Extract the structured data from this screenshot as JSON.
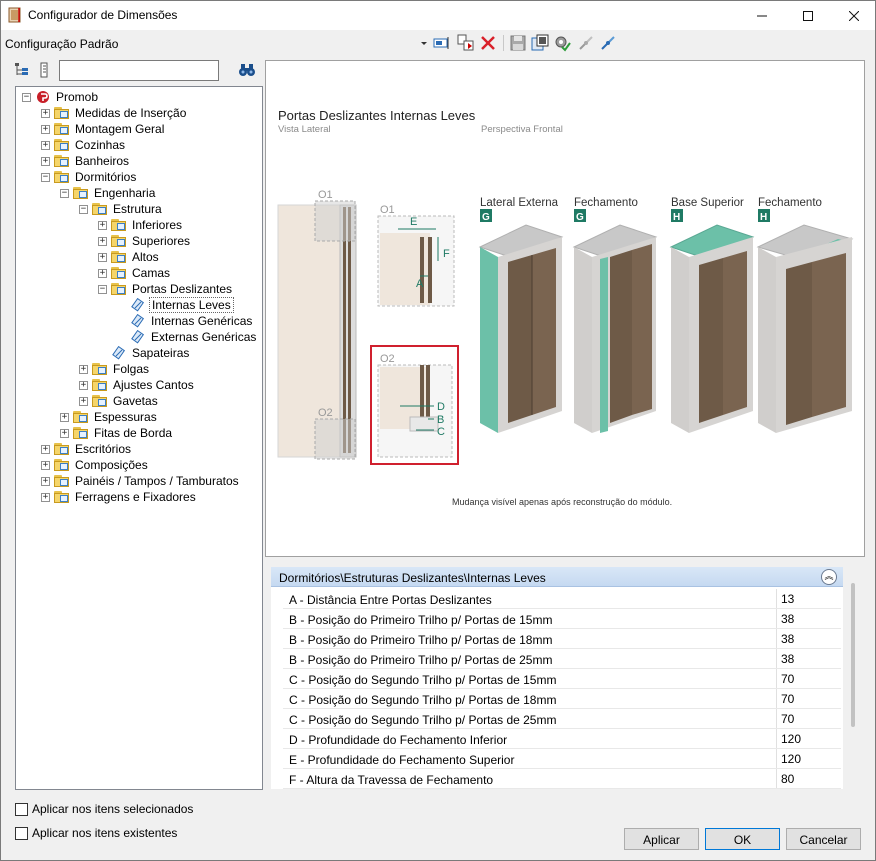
{
  "window": {
    "title": "Configurador de Dimensões"
  },
  "toolbar": {
    "config_name": "Configuração Padrão",
    "search_value": ""
  },
  "tree": {
    "items": [
      {
        "label": "Promob",
        "level": 0,
        "expander": "-",
        "icon": "promob"
      },
      {
        "label": "Medidas de Inserção",
        "level": 1,
        "expander": "+",
        "icon": "folder"
      },
      {
        "label": "Montagem Geral",
        "level": 1,
        "expander": "+",
        "icon": "folder"
      },
      {
        "label": "Cozinhas",
        "level": 1,
        "expander": "+",
        "icon": "folder"
      },
      {
        "label": "Banheiros",
        "level": 1,
        "expander": "+",
        "icon": "folder"
      },
      {
        "label": "Dormitórios",
        "level": 1,
        "expander": "-",
        "icon": "folder"
      },
      {
        "label": "Engenharia",
        "level": 2,
        "expander": "-",
        "icon": "folder"
      },
      {
        "label": "Estrutura",
        "level": 3,
        "expander": "-",
        "icon": "folder"
      },
      {
        "label": "Inferiores",
        "level": 4,
        "expander": "+",
        "icon": "folder"
      },
      {
        "label": "Superiores",
        "level": 4,
        "expander": "+",
        "icon": "folder"
      },
      {
        "label": "Altos",
        "level": 4,
        "expander": "+",
        "icon": "folder"
      },
      {
        "label": "Camas",
        "level": 4,
        "expander": "+",
        "icon": "folder"
      },
      {
        "label": "Portas Deslizantes",
        "level": 4,
        "expander": "-",
        "icon": "folder"
      },
      {
        "label": "Internas Leves",
        "level": 5,
        "expander": "",
        "icon": "item",
        "selected": true
      },
      {
        "label": "Internas Genéricas",
        "level": 5,
        "expander": "",
        "icon": "item"
      },
      {
        "label": "Externas Genéricas",
        "level": 5,
        "expander": "",
        "icon": "item"
      },
      {
        "label": "Sapateiras",
        "level": 4,
        "expander": "",
        "icon": "item"
      },
      {
        "label": "Folgas",
        "level": 3,
        "expander": "+",
        "icon": "folder"
      },
      {
        "label": "Ajustes Cantos",
        "level": 3,
        "expander": "+",
        "icon": "folder"
      },
      {
        "label": "Gavetas",
        "level": 3,
        "expander": "+",
        "icon": "folder"
      },
      {
        "label": "Espessuras",
        "level": 2,
        "expander": "+",
        "icon": "folder"
      },
      {
        "label": "Fitas de Borda",
        "level": 2,
        "expander": "+",
        "icon": "folder"
      },
      {
        "label": "Escritórios",
        "level": 1,
        "expander": "+",
        "icon": "folder"
      },
      {
        "label": "Composições",
        "level": 1,
        "expander": "+",
        "icon": "folder"
      },
      {
        "label": "Painéis / Tampos / Tamburatos",
        "level": 1,
        "expander": "+",
        "icon": "folder"
      },
      {
        "label": "Ferragens e Fixadores",
        "level": 1,
        "expander": "+",
        "icon": "folder"
      }
    ]
  },
  "preview": {
    "title": "Portas Deslizantes Internas Leves",
    "side_view": "Vista Lateral",
    "front_view": "Perspectiva Frontal",
    "o1": "O1",
    "o2": "O2",
    "dim_a": "A",
    "dim_b": "B",
    "dim_c": "C",
    "dim_d": "D",
    "dim_e": "E",
    "dim_f": "F",
    "modules": [
      {
        "label": "Lateral Externa",
        "tag": "G"
      },
      {
        "label": "Fechamento",
        "tag": "G"
      },
      {
        "label": "Base Superior",
        "tag": "H"
      },
      {
        "label": "Fechamento",
        "tag": "H"
      }
    ],
    "note": "Mudança visível apenas após reconstrução do módulo."
  },
  "properties": {
    "header": "Dormitórios\\Estruturas Deslizantes\\Internas Leves",
    "rows": [
      {
        "name": "A - Distância Entre Portas Deslizantes",
        "value": "13"
      },
      {
        "name": "B - Posição do Primeiro Trilho p/ Portas de 15mm",
        "value": "38"
      },
      {
        "name": "B - Posição do Primeiro Trilho p/ Portas de 18mm",
        "value": "38"
      },
      {
        "name": "B - Posição do Primeiro Trilho p/ Portas de 25mm",
        "value": "38"
      },
      {
        "name": "C - Posição do Segundo Trilho p/ Portas de 15mm",
        "value": "70"
      },
      {
        "name": "C - Posição do Segundo Trilho p/ Portas de 18mm",
        "value": "70"
      },
      {
        "name": "C - Posição do Segundo Trilho p/ Portas de 25mm",
        "value": "70"
      },
      {
        "name": "D - Profundidade do Fechamento Inferior",
        "value": "120"
      },
      {
        "name": "E - Profundidade do Fechamento Superior",
        "value": "120"
      },
      {
        "name": "F - Altura da Travessa de Fechamento",
        "value": "80"
      }
    ]
  },
  "options": {
    "apply_selected": "Aplicar nos itens selecionados",
    "apply_existing": "Aplicar nos itens existentes"
  },
  "buttons": {
    "apply": "Aplicar",
    "ok": "OK",
    "cancel": "Cancelar"
  },
  "colors": {
    "accent_teal": "#6cc0a8",
    "tag_green": "#1f7a64",
    "highlight_red": "#d0202e",
    "wood": "#6e5a47"
  }
}
